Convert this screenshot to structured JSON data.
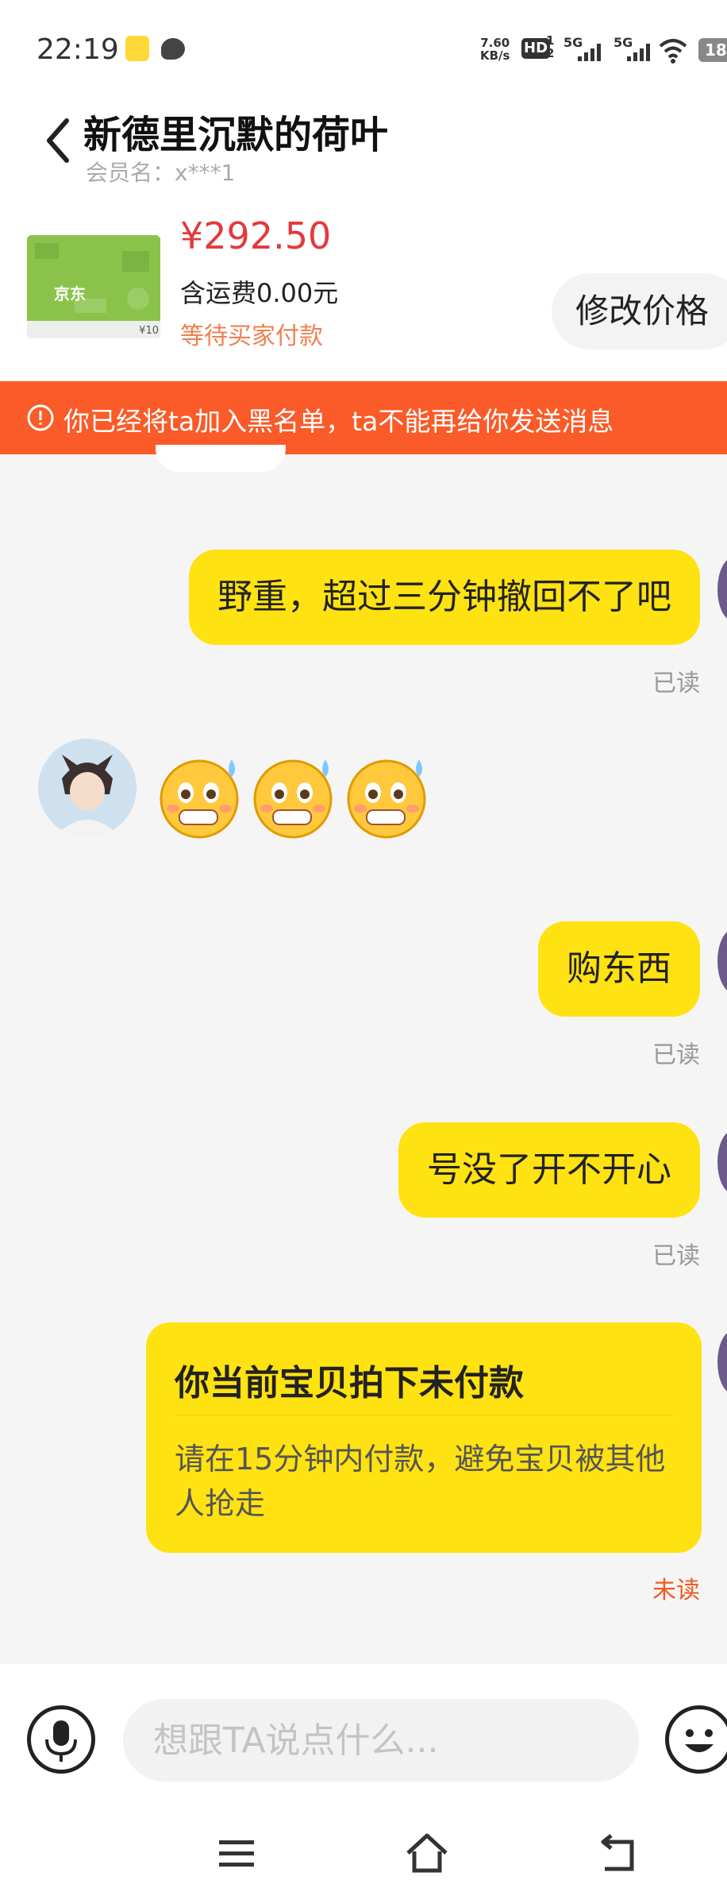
{
  "status_bar": {
    "time": "22:19",
    "net_speed_value": "7.60",
    "net_speed_unit": "KB/s",
    "hd_label": "HD",
    "hd_sub_top": "1",
    "hd_sub_bottom": "2",
    "sim1_label": "5G",
    "sim2_label": "5G",
    "battery": "18",
    "icons": [
      "app-notification-icon",
      "message-icon",
      "hd-icon",
      "signal-icon",
      "wifi-icon",
      "battery-icon"
    ]
  },
  "header": {
    "title": "新德里沉默的荷叶",
    "member_name": "会员名：x***1"
  },
  "order": {
    "price": "¥292.50",
    "shipping": "含运费0.00元",
    "status": "等待买家付款",
    "modify_price_label": "修改价格",
    "thumb_logo": "京东",
    "thumb_price": "¥10"
  },
  "banner": {
    "text": "你已经将ta加入黑名单，ta不能再给你发送消息"
  },
  "messages": [
    {
      "text": "野重，超过三分钟撤回不了吧",
      "status": "已读"
    },
    {
      "text": "购东西",
      "status": "已读"
    },
    {
      "text": "号没了开不开心",
      "status": "已读"
    }
  ],
  "incoming": {
    "emojis": [
      "sweat-smile-emoji",
      "sweat-smile-emoji",
      "sweat-smile-emoji"
    ]
  },
  "payment_card": {
    "title": "你当前宝贝拍下未付款",
    "body": "请在15分钟内付款，避免宝贝被其他人抢走",
    "status": "未读"
  },
  "input": {
    "placeholder": "想跟TA说点什么..."
  },
  "colors": {
    "bubble": "#ffe211",
    "banner": "#fa5b28",
    "price": "#e4393c",
    "order_status": "#f08050",
    "unread": "#f25a1f"
  }
}
